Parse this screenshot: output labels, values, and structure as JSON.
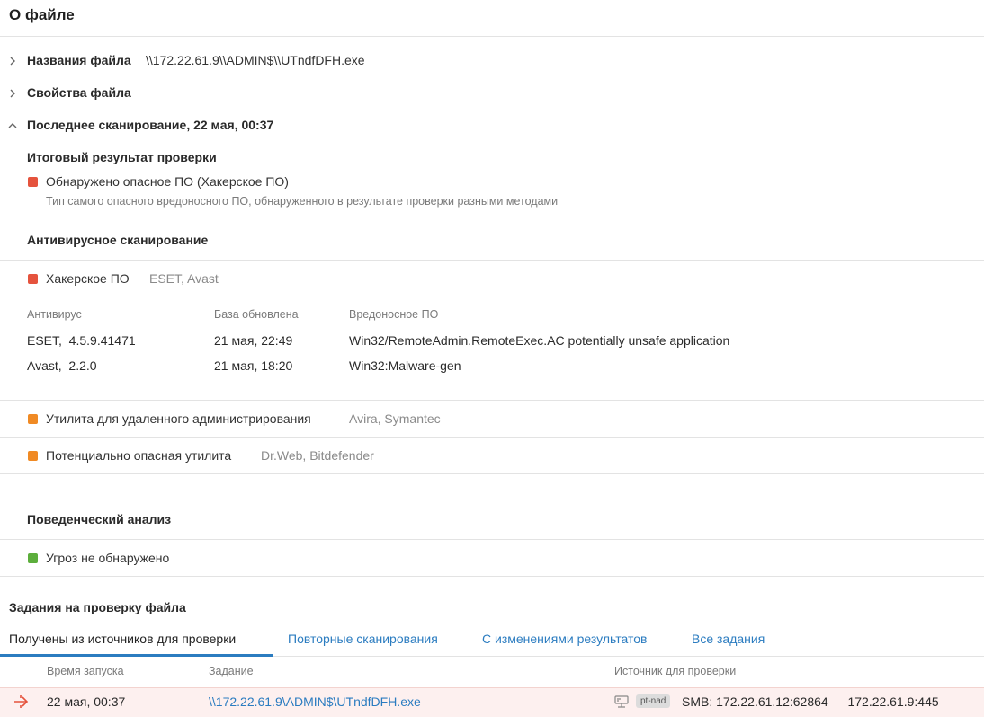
{
  "header": {
    "title": "О файле"
  },
  "sections": {
    "names": {
      "label": "Названия файла",
      "value": "\\\\172.22.61.9\\\\ADMIN$\\\\UTndfDFH.exe"
    },
    "props": {
      "label": "Свойства файла"
    },
    "last_scan": {
      "label": "Последнее сканирование, 22 мая, 00:37"
    }
  },
  "verdict": {
    "heading": "Итоговый результат проверки",
    "result": "Обнаружено опасное ПО (Хакерское ПО)",
    "hint": "Тип самого опасного вредоносного ПО, обнаруженного в результате проверки разными методами",
    "color": "#e5533d"
  },
  "av": {
    "heading": "Антивирусное сканирование",
    "groups": [
      {
        "name": "Хакерское ПО",
        "engines": "ESET, Avast",
        "color": "#e5533d"
      },
      {
        "name": "Утилита для удаленного администрирования",
        "engines": "Avira, Symantec",
        "color": "#f08a24"
      },
      {
        "name": "Потенциально опасная утилита",
        "engines": "Dr.Web, Bitdefender",
        "color": "#f08a24"
      }
    ],
    "columns": [
      "Антивирус",
      "База обновлена",
      "Вредоносное ПО"
    ],
    "rows": [
      [
        "ESET,  4.5.9.41471",
        "21 мая, 22:49",
        "Win32/RemoteAdmin.RemoteExec.AC potentially unsafe application"
      ],
      [
        "Avast,  2.2.0",
        "21 мая, 18:20",
        "Win32:Malware-gen"
      ]
    ]
  },
  "behavior": {
    "heading": "Поведенческий анализ",
    "result": "Угроз не обнаружено",
    "color": "#5cae3c"
  },
  "tasks": {
    "heading": "Задания на проверку файла",
    "tabs": [
      "Получены из источников для проверки",
      "Повторные сканирования",
      "С изменениями результатов",
      "Все задания"
    ],
    "active_tab": 0,
    "columns": [
      "Время запуска",
      "Задание",
      "Источник для проверки"
    ],
    "rows": [
      {
        "time": "22 мая, 00:37",
        "task": "\\\\172.22.61.9\\ADMIN$\\UTndfDFH.exe",
        "badge": "pt-nad",
        "source": "SMB: 172.22.61.12:62864 — 172.22.61.9:445"
      }
    ]
  },
  "icons": {
    "collapsed": "chevron-right-icon",
    "expanded": "chevron-up-icon",
    "row_type": "network-flow-icon",
    "source_type": "network-device-icon"
  },
  "colors": {
    "accent": "#2b7cc0",
    "danger": "#e5533d",
    "warning": "#f08a24",
    "ok": "#5cae3c"
  }
}
